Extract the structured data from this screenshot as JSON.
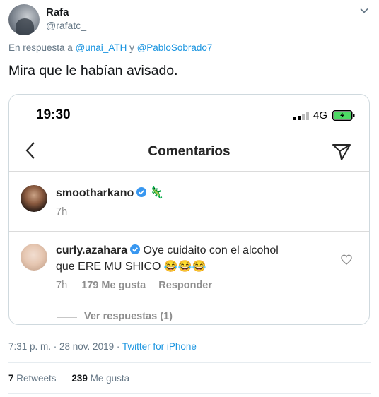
{
  "author": {
    "name": "Rafa",
    "handle": "@rafatc_"
  },
  "reply_to": {
    "prefix": "En respuesta a",
    "mention1": "@unai_ATH",
    "joiner": "y",
    "mention2": "@PabloSobrado7"
  },
  "tweet_text": "Mira que le habían avisado.",
  "screenshot": {
    "status_time": "19:30",
    "network": "4G",
    "title": "Comentarios",
    "comments": [
      {
        "user": "smootharkano",
        "text": "🦎",
        "time": "7h"
      },
      {
        "user": "curly.azahara",
        "text_line1": "Oye cuidaito con el alcohol",
        "text_line2": "que ERE MU SHICO 😂😂😂",
        "time": "7h",
        "likes": "179 Me gusta",
        "reply": "Responder"
      }
    ],
    "view_replies": "Ver respuestas (1)"
  },
  "footer": {
    "timestamp": "7:31 p. m. · 28 nov. 2019 ·",
    "source": "Twitter for iPhone",
    "retweets_count": "7",
    "retweets_label": "Retweets",
    "likes_count": "239",
    "likes_label": "Me gusta"
  },
  "colors": {
    "link": "#1b95e0",
    "muted": "#657786",
    "verified": "#3897f0",
    "battery": "#4cd964"
  }
}
